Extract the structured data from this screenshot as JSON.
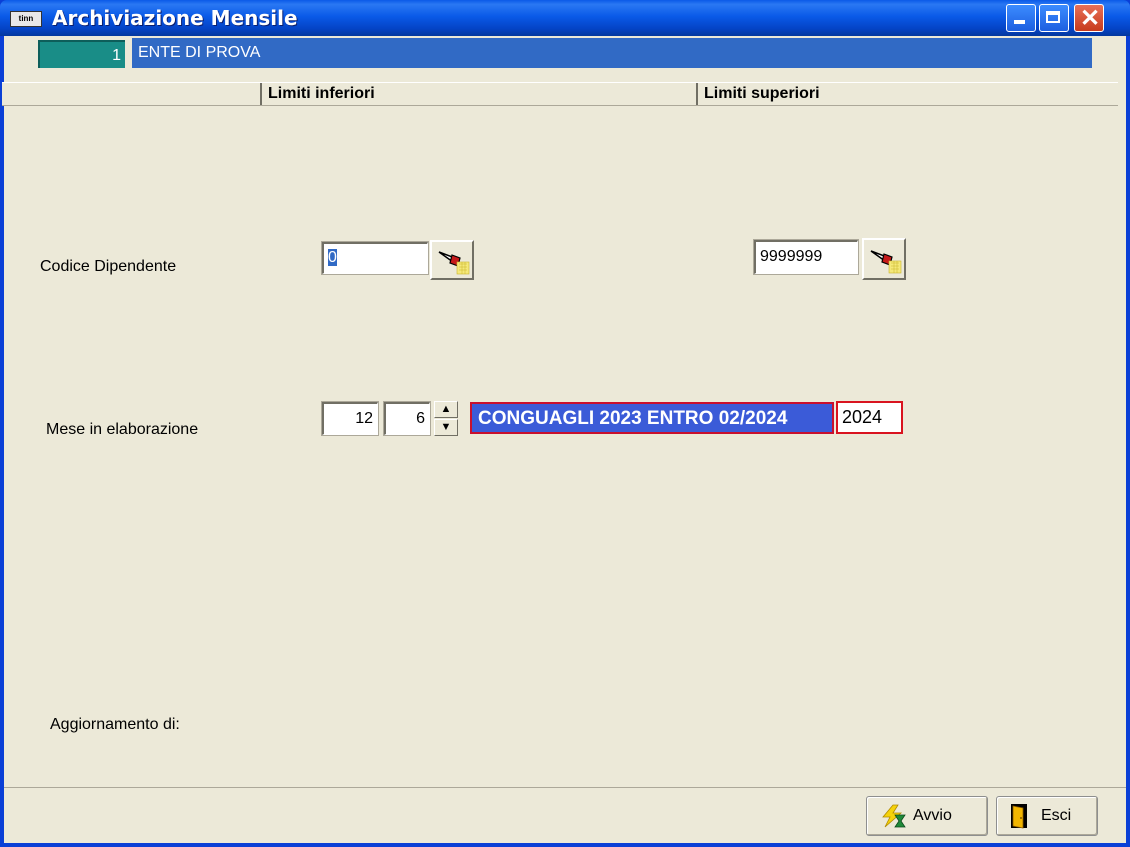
{
  "window": {
    "title": "Archiviazione Mensile",
    "app_icon_text": "tinn"
  },
  "ente": {
    "code": "1",
    "name": "ENTE DI PROVA"
  },
  "columns": {
    "lower": "Limiti inferiori",
    "upper": "Limiti superiori"
  },
  "fields": {
    "codice_dipendente": {
      "label": "Codice Dipendente",
      "lower_value": "0",
      "upper_value": "9999999"
    },
    "mese": {
      "label": "Mese in elaborazione",
      "month": "12",
      "period": "6",
      "description": "CONGUAGLI 2023 ENTRO 02/2024",
      "year": "2024"
    },
    "aggiornamento": {
      "label": "Aggiornamento di:"
    }
  },
  "actions": {
    "avvio": "Avvio",
    "esci": "Esci"
  },
  "colors": {
    "title_bar": "#0a5ae8",
    "ente_code_bg": "#198d87",
    "ente_name_bg": "#316ac5",
    "mese_desc_bg": "#3b5bd8",
    "highlight_border": "#d9141f"
  }
}
